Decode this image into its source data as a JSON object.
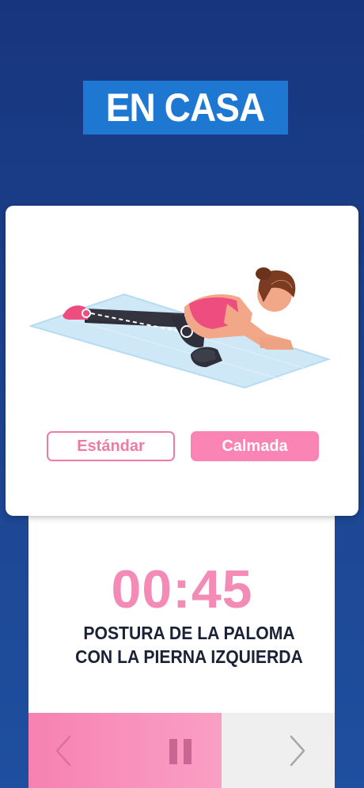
{
  "header": {
    "title": "EN CASA"
  },
  "modes": {
    "standard_label": "Estándar",
    "calm_label": "Calmada",
    "selected": "Calmada"
  },
  "timer": {
    "value": "00:45"
  },
  "exercise": {
    "name_line1": "POSTURA DE LA PALOMA",
    "name_line2": "CON LA PIERNA IZQUIERDA"
  },
  "controls": {
    "prev_icon": "chevron-left-icon",
    "pause_icon": "pause-icon",
    "next_icon": "chevron-right-icon"
  },
  "colors": {
    "background": "#1d4590",
    "title_bg": "#1e78d2",
    "accent_pink": "#fa84b4",
    "timer_pink": "#f48ab6",
    "control_gray": "#efefef"
  }
}
